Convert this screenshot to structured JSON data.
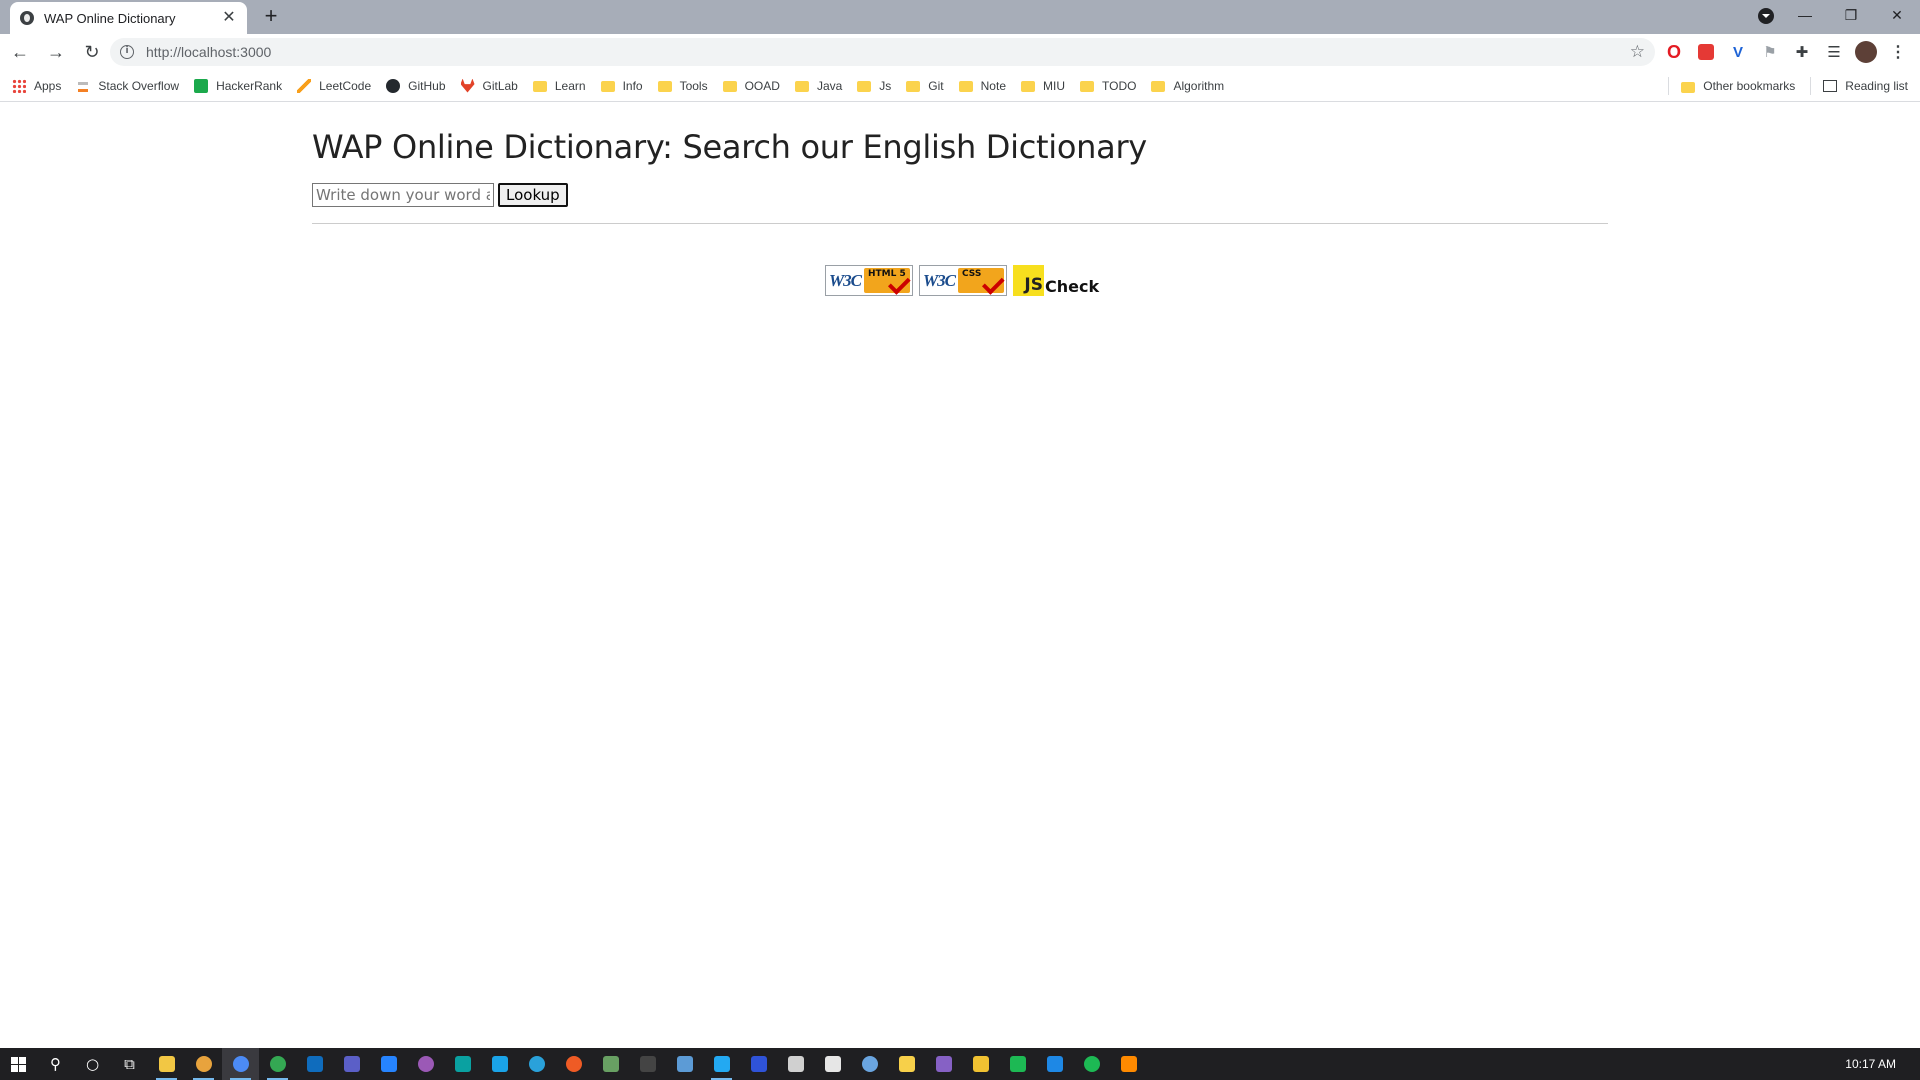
{
  "browser": {
    "tab": {
      "title": "WAP Online Dictionary",
      "close": "✕"
    },
    "new_tab": "+",
    "window_controls": {
      "minimize": "—",
      "restore": "❐",
      "close": "✕"
    },
    "nav": {
      "back": "←",
      "forward": "→",
      "reload": "↻"
    },
    "address": {
      "url": "http://localhost:3000",
      "info": "i",
      "star": "☆"
    },
    "extensions": {
      "vpn": "V",
      "flag": "⚑",
      "puzzle": "✚",
      "list": "☰",
      "menu": "⋮",
      "opera": "O"
    },
    "bookmarks": [
      {
        "label": "Apps",
        "icon": "apps-icon"
      },
      {
        "label": "Stack Overflow",
        "icon": "stackoverflow-icon"
      },
      {
        "label": "HackerRank",
        "icon": "hackerrank-icon"
      },
      {
        "label": "LeetCode",
        "icon": "leetcode-icon"
      },
      {
        "label": "GitHub",
        "icon": "github-icon"
      },
      {
        "label": "GitLab",
        "icon": "gitlab-icon"
      },
      {
        "label": "Learn",
        "icon": "folder-icon"
      },
      {
        "label": "Info",
        "icon": "folder-icon"
      },
      {
        "label": "Tools",
        "icon": "folder-icon"
      },
      {
        "label": "OOAD",
        "icon": "folder-icon"
      },
      {
        "label": "Java",
        "icon": "folder-icon"
      },
      {
        "label": "Js",
        "icon": "folder-icon"
      },
      {
        "label": "Git",
        "icon": "folder-icon"
      },
      {
        "label": "Note",
        "icon": "folder-icon"
      },
      {
        "label": "MIU",
        "icon": "folder-icon"
      },
      {
        "label": "TODO",
        "icon": "folder-icon"
      },
      {
        "label": "Algorithm",
        "icon": "folder-icon"
      }
    ],
    "other_bookmarks": "Other bookmarks",
    "reading_list": "Reading list"
  },
  "page": {
    "heading": "WAP Online Dictionary: Search our English Dictionary",
    "search": {
      "placeholder": "Write down your word and search",
      "button_label": "Lookup"
    },
    "badges": {
      "html_w3c": "W3C",
      "html_tag": "HTML 5",
      "css_w3c": "W3C",
      "css_tag": "CSS",
      "js_tag": "JS",
      "js_text": "Check"
    }
  },
  "taskbar": {
    "clock": "10:17 AM",
    "search_glyph": "⚲",
    "cortana_glyph": "○",
    "taskview_glyph": "⧉",
    "apps": [
      {
        "name": "file-explorer",
        "color": "#f2c744"
      },
      {
        "name": "chrome",
        "color": "#e8a33d"
      },
      {
        "name": "chrome-active",
        "color": "#4c8bf5"
      },
      {
        "name": "chrome-dev",
        "color": "#34a853"
      },
      {
        "name": "outlook",
        "color": "#0f6cbd"
      },
      {
        "name": "teams",
        "color": "#5b5fc7"
      },
      {
        "name": "sourcetree",
        "color": "#2684ff"
      },
      {
        "name": "podcast",
        "color": "#9b59b6"
      },
      {
        "name": "app-teal",
        "color": "#0aa1a1"
      },
      {
        "name": "app-cyan",
        "color": "#1aa3e8"
      },
      {
        "name": "telegram",
        "color": "#2aa1da"
      },
      {
        "name": "postman",
        "color": "#ef5b25"
      },
      {
        "name": "node",
        "color": "#68a063"
      },
      {
        "name": "terminal",
        "color": "#444444"
      },
      {
        "name": "app-blue",
        "color": "#5c9bd6"
      },
      {
        "name": "vscode",
        "color": "#23a9f2"
      },
      {
        "name": "intellij",
        "color": "#2f53d8"
      },
      {
        "name": "app-white",
        "color": "#d0d0d0"
      },
      {
        "name": "app-shield",
        "color": "#e6e6e6"
      },
      {
        "name": "app-circle",
        "color": "#6aa5e0"
      },
      {
        "name": "sticky-notes",
        "color": "#f7d04a"
      },
      {
        "name": "visual-studio",
        "color": "#8661c5"
      },
      {
        "name": "app-yellow",
        "color": "#f1c232"
      },
      {
        "name": "app-green",
        "color": "#1db954"
      },
      {
        "name": "app-azure",
        "color": "#1e88e5"
      },
      {
        "name": "spotify",
        "color": "#1db954"
      },
      {
        "name": "app-orange",
        "color": "#ff8a00"
      }
    ]
  }
}
